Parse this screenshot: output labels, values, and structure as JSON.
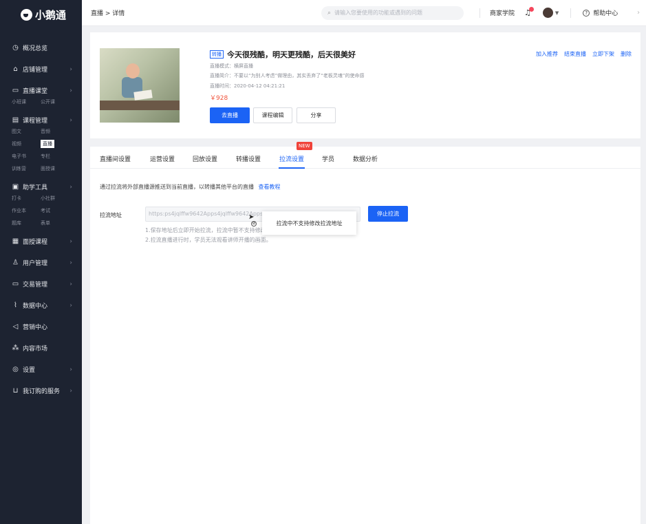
{
  "sidebar": {
    "brand": "小鹅通",
    "items": [
      {
        "label": "概况总览",
        "icon": "dashboard-icon",
        "glyph": "◷",
        "chevron": false
      },
      {
        "label": "店铺管理",
        "icon": "store-icon",
        "glyph": "⌂",
        "chevron": true
      },
      {
        "label": "直播课堂",
        "icon": "live-camera-icon",
        "glyph": "▭",
        "chevron": true,
        "sub": [
          "小班课",
          "公开课"
        ]
      },
      {
        "label": "课程管理",
        "icon": "course-icon",
        "glyph": "▤",
        "chevron": true,
        "sub": [
          "图文",
          "音频",
          "视频",
          "直播",
          "电子书",
          "专栏",
          "训练营",
          "面授课"
        ],
        "active_sub": "直播"
      },
      {
        "label": "助学工具",
        "icon": "toolbox-icon",
        "glyph": "▣",
        "chevron": true,
        "sub": [
          "打卡",
          "小社群",
          "作业本",
          "考试",
          "题库",
          "表单"
        ]
      },
      {
        "label": "面授课程",
        "icon": "classroom-icon",
        "glyph": "▦",
        "chevron": true
      },
      {
        "label": "用户管理",
        "icon": "user-icon",
        "glyph": "♙",
        "chevron": true
      },
      {
        "label": "交易管理",
        "icon": "transaction-icon",
        "glyph": "▭",
        "chevron": true
      },
      {
        "label": "数据中心",
        "icon": "chart-line-icon",
        "glyph": "⌇",
        "chevron": true
      },
      {
        "label": "营销中心",
        "icon": "megaphone-icon",
        "glyph": "◁",
        "chevron": false
      },
      {
        "label": "内容市场",
        "icon": "hierarchy-icon",
        "glyph": "⁂",
        "chevron": false
      },
      {
        "label": "设置",
        "icon": "settings-icon",
        "glyph": "◎",
        "chevron": true
      },
      {
        "label": "我订购的服务",
        "icon": "cart-icon",
        "glyph": "⊔",
        "chevron": true
      }
    ]
  },
  "topbar": {
    "breadcrumb": "直播 > 详情",
    "search_placeholder": "请输入您要使用的功能或遇到的问题",
    "merchant_academy": "商家学院",
    "help_center": "帮助中心"
  },
  "course": {
    "tag": "转播",
    "title": "今天很残酷，明天更残酷，后天很美好",
    "mode": "直播模式：横屏直播",
    "intro": "直播简介：不要以“为别人考虑”做理由，其实丢弃了“老板灵魂”的使命感",
    "time": "直播时间：2020-04-12 04:21:21",
    "price": "￥928",
    "buttons": {
      "go_live": "去直播",
      "edit": "课程编辑",
      "share": "分享"
    },
    "actions": {
      "recommend": "加入推荐",
      "end_live": "结束直播",
      "unpublish": "立即下架",
      "delete": "删除"
    }
  },
  "tabs": [
    "直播间设置",
    "运营设置",
    "回放设置",
    "转播设置",
    "拉流设置",
    "学员",
    "数据分析"
  ],
  "active_tab": "拉流设置",
  "new_badge": "NEW",
  "pull_stream": {
    "intro": "通过拉流将外部直播源推送到当前直播，以转播其他平台的直播",
    "tutorial_link": "查看教程",
    "label": "拉流地址",
    "url": "https:ps4jqlffw9642Apps4jqlffw9642Apps4jqlffw9642App",
    "stop_button": "停止拉流",
    "note1": "1.保存地址后立即开始拉流，拉流中暂不支持修改地址",
    "note2": "2.拉流直播进行时，学员无法观看讲师开播的画面。",
    "tooltip": "拉流中不支持修改拉流地址"
  }
}
